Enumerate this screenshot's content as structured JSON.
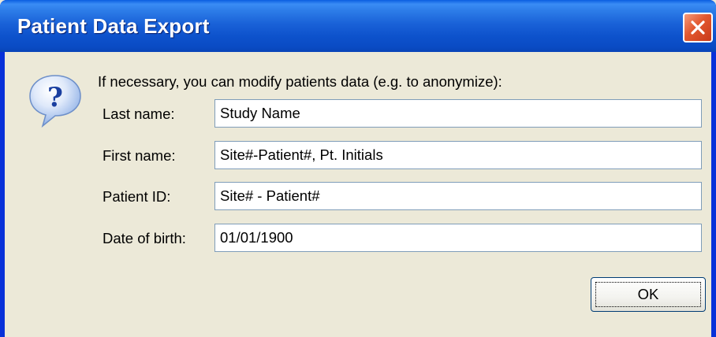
{
  "window": {
    "title": "Patient Data Export"
  },
  "dialog": {
    "icon": "question-icon",
    "prompt": "If necessary, you can modify patients data (e.g. to anonymize):",
    "fields": [
      {
        "label": "Last name:",
        "value": "Study Name"
      },
      {
        "label": "First name:",
        "value": "Site#-Patient#, Pt. Initials"
      },
      {
        "label": "Patient ID:",
        "value": "Site# - Patient#"
      },
      {
        "label": "Date of birth:",
        "value": "01/01/1900"
      }
    ],
    "ok_label": "OK"
  },
  "colors": {
    "titlebar": "#0a4bc4",
    "close_button": "#e2572e",
    "dialog_background": "#ece9d8",
    "input_border": "#7f9db9"
  }
}
